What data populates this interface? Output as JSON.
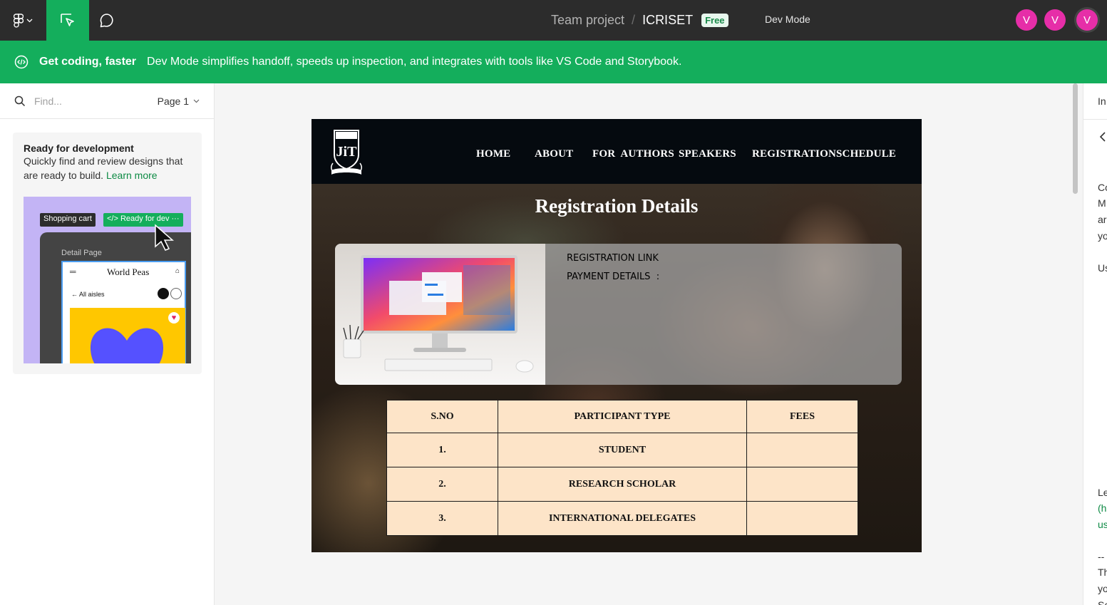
{
  "topbar": {
    "project": "Team project",
    "separator": "/",
    "file": "ICRISET",
    "plan_badge": "Free",
    "dev_mode": "Dev Mode",
    "avatars": [
      "V",
      "V",
      "V"
    ]
  },
  "banner": {
    "title": "Get coding, faster",
    "text": "Dev Mode simplifies handoff, speeds up inspection, and integrates with tools like VS Code and Storybook."
  },
  "left_panel": {
    "search_placeholder": "Find...",
    "page": "Page 1",
    "card": {
      "title": "Ready for development",
      "desc": "Quickly find and review designs that are ready to build.",
      "link": "Learn more",
      "illustration": {
        "chip_cart": "Shopping cart",
        "chip_ready": "Ready for dev",
        "label": "Detail Page",
        "title": "World Peas",
        "back": "All aisles"
      }
    }
  },
  "design": {
    "nav": [
      "HOME",
      "ABOUT",
      "FOR  AUTHORS",
      "SPEAKERS",
      "REGISTRATION",
      "SCHEDULE"
    ],
    "title": "Registration Details",
    "reg_link": "REGISTRATION LINK",
    "payment": "PAYMENT DETAILS  :",
    "table": {
      "headers": [
        "S.NO",
        "PARTICIPANT TYPE",
        "FEES"
      ],
      "rows": [
        {
          "sno": "1.",
          "type": "STUDENT",
          "fees": ""
        },
        {
          "sno": "2.",
          "type": "RESEARCH SCHOLAR",
          "fees": ""
        },
        {
          "sno": "3.",
          "type": "INTERNATIONAL DELEGATES",
          "fees": ""
        }
      ]
    }
  },
  "right_panel": {
    "lines": [
      "In",
      "Co",
      "M",
      "ar",
      "yo",
      "Us",
      "Le",
      "(h",
      "us",
      "--",
      "Th",
      "yo",
      "Sc"
    ]
  },
  "colors": {
    "topbar": "#2c2c2c",
    "accent_green": "#14ae5c",
    "avatar": "#e62ea8",
    "table_bg": "#fde4c8"
  }
}
